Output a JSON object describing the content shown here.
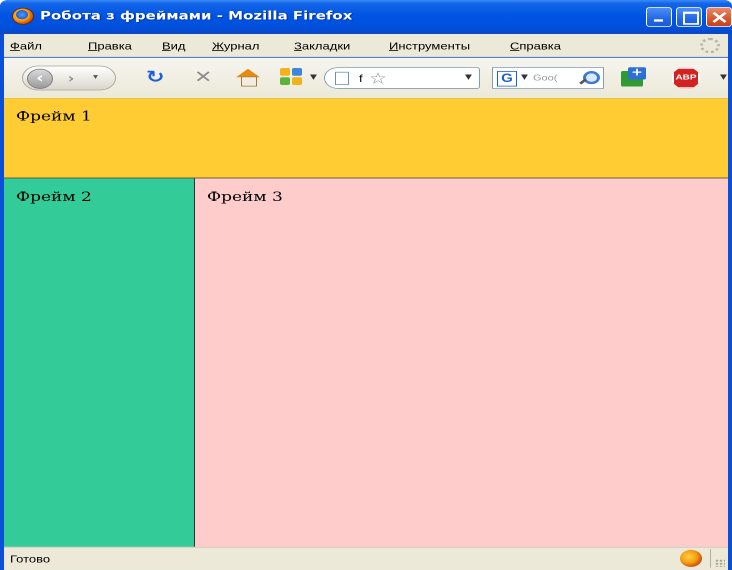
{
  "window": {
    "title": "Робота з фреймами - Mozilla Firefox",
    "buttons": {
      "minimize": "minimize-icon",
      "maximize": "maximize-icon",
      "close": "close-icon"
    }
  },
  "menu": {
    "items": [
      {
        "first": "Ф",
        "rest": "айл"
      },
      {
        "first": "П",
        "rest": "равка"
      },
      {
        "first": "В",
        "rest": "ид"
      },
      {
        "first": "Ж",
        "rest": "урнал"
      },
      {
        "first": "З",
        "rest": "акладки"
      },
      {
        "first": "И",
        "rest": "нструменты"
      },
      {
        "first": "С",
        "rest": "правка"
      }
    ]
  },
  "toolbar": {
    "url_text": "f",
    "search_text": "Goo(",
    "search_engine_letter": "G",
    "adblock_label": "ABP",
    "icons": [
      "back-icon",
      "forward-icon",
      "reload-icon",
      "stop-icon",
      "home-icon",
      "tiles-icon",
      "page-icon",
      "star-icon",
      "google-icon",
      "magnifier-icon",
      "addon-icon",
      "adblock-icon"
    ]
  },
  "frames": {
    "frame1": {
      "label": "Фрейм 1",
      "color": "#ffcc33"
    },
    "frame2": {
      "label": "Фрейм 2",
      "color": "#33cc99"
    },
    "frame3": {
      "label": "Фрейм 3",
      "color": "#ffcccc"
    }
  },
  "status": {
    "text": "Готово"
  }
}
